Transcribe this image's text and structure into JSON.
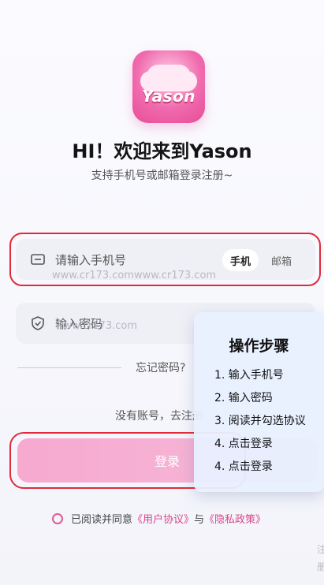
{
  "app": {
    "logo_text": "Yason",
    "title": "HI！欢迎来到Yason",
    "subtitle": "支持手机号或邮箱登录注册~"
  },
  "phone_field": {
    "placeholder": "请输入手机号",
    "tabs": [
      "手机",
      "邮箱"
    ],
    "active_tab": "手机"
  },
  "password_field": {
    "placeholder": "输入密码"
  },
  "watermarks": {
    "line1": "www.cr173.comwww.cr173.com",
    "line2": "www.cr173.com"
  },
  "links": {
    "forgot": "忘记密码?",
    "register": "没有账号，去注册"
  },
  "login_button": "登录",
  "steps_panel": {
    "title": "操作步骤",
    "items": [
      "1. 输入手机号",
      "2. 输入密码",
      "3. 阅读并勾选协议",
      "4. 点击登录",
      "4. 点击登录"
    ]
  },
  "agreement": {
    "prefix": "已阅读并同意",
    "user_agreement": "《用户协议》",
    "and": "与",
    "privacy_policy": "《隐私政策》"
  },
  "corner_text": [
    "注",
    "册"
  ],
  "colors": {
    "accent": "#e84d97",
    "highlight_outline": "#e02a3a",
    "button": "#f7a9cf"
  }
}
